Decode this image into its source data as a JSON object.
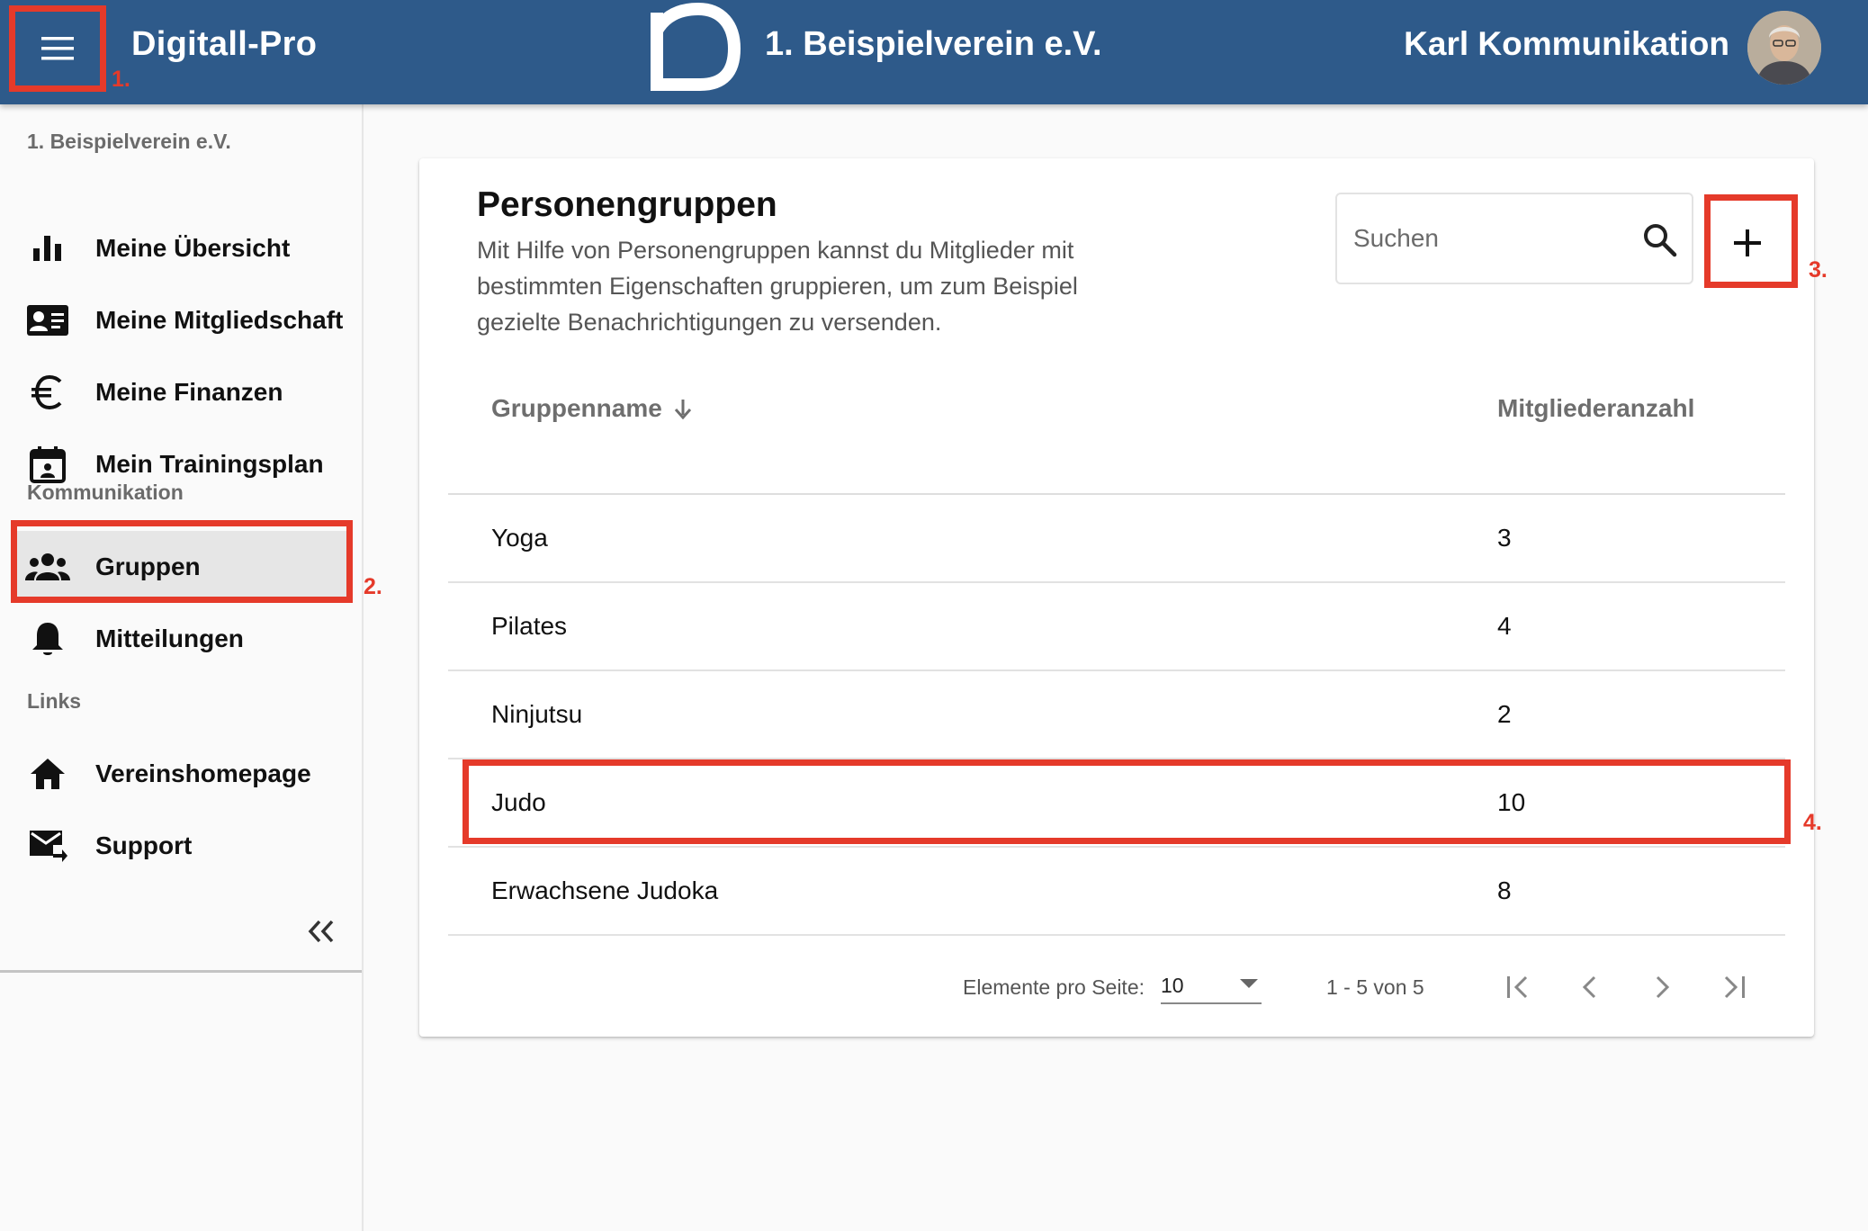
{
  "header": {
    "app_title": "Digitall-Pro",
    "club_name": "1. Beispielverein e.V.",
    "user_name": "Karl Kommunikation",
    "background_color": "#2e5a8a"
  },
  "sidebar": {
    "org_label": "1. Beispielverein e.V.",
    "items_main": [
      {
        "label": "Meine Übersicht",
        "icon": "bar-chart-icon"
      },
      {
        "label": "Meine Mitgliedschaft",
        "icon": "id-card-icon"
      },
      {
        "label": "Meine Finanzen",
        "icon": "euro-icon"
      },
      {
        "label": "Mein Trainingsplan",
        "icon": "calendar-icon"
      }
    ],
    "section_communication": "Kommunikation",
    "items_communication": [
      {
        "label": "Gruppen",
        "icon": "group-icon",
        "active": true
      },
      {
        "label": "Mitteilungen",
        "icon": "bell-icon"
      }
    ],
    "section_links": "Links",
    "items_links": [
      {
        "label": "Vereinshomepage",
        "icon": "home-icon"
      },
      {
        "label": "Support",
        "icon": "mail-forward-icon"
      }
    ],
    "collapse_icon": "double-chevron-left-icon"
  },
  "card": {
    "title": "Personengruppen",
    "description": "Mit Hilfe von Personengruppen kannst du Mitglieder mit bestimmten Eigenschaften gruppieren, um zum Beispiel gezielte Benachrichtigungen zu versenden.",
    "search_placeholder": "Suchen",
    "add_icon": "plus-icon"
  },
  "table": {
    "columns": [
      "Gruppenname",
      "Mitgliederanzahl"
    ],
    "sort_icon": "arrow-down-icon",
    "rows": [
      {
        "name": "Yoga",
        "count": "3"
      },
      {
        "name": "Pilates",
        "count": "4"
      },
      {
        "name": "Ninjutsu",
        "count": "2"
      },
      {
        "name": "Judo",
        "count": "10"
      },
      {
        "name": "Erwachsene Judoka",
        "count": "8"
      }
    ]
  },
  "paginator": {
    "items_per_page_label": "Elemente pro Seite:",
    "items_per_page_value": "10",
    "range_label": "1 - 5 von 5"
  },
  "annotations": {
    "a1": "1.",
    "a2": "2.",
    "a3": "3.",
    "a4": "4.",
    "color": "#e53a2a"
  }
}
